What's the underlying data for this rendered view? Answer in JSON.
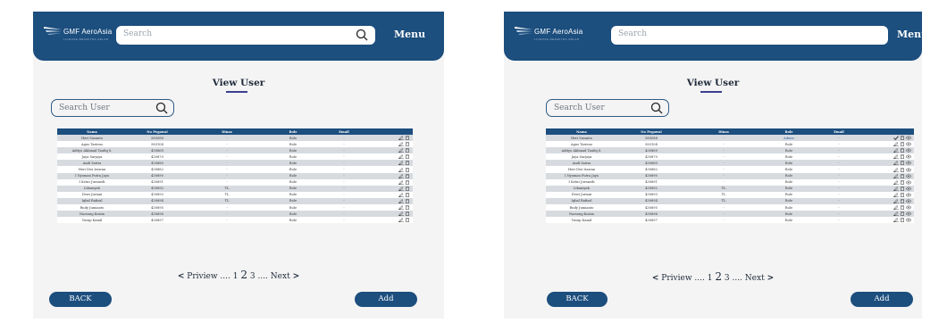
{
  "logo": {
    "name": "GMF AeroAsia",
    "tagline": "LICENSE BERMITRA ABLAR"
  },
  "header": {
    "search_placeholder": "Search",
    "menu_label": "Menu"
  },
  "page": {
    "title": "View User"
  },
  "user_search": {
    "placeholder": "Search User"
  },
  "columns": [
    "Nama",
    "No Pegawai",
    "Dinas",
    "Role",
    "Email"
  ],
  "rows_left": [
    [
      "Heri Susanto",
      "583088",
      "-",
      "Role",
      "-"
    ],
    [
      "Agus Tarieno",
      "583104",
      "-",
      "Role",
      "-"
    ],
    [
      "Adityo Akhmad Taufiq S.",
      "430869",
      "-",
      "Role",
      "-"
    ],
    [
      "Jaya Surjaya",
      "430870",
      "-",
      "Role",
      "-"
    ],
    [
      "Andi Satria",
      "430880",
      "-",
      "Role",
      "-"
    ],
    [
      "Heri Dwi Irawan",
      "430882",
      "-",
      "Role",
      "-"
    ],
    [
      "I Nyoman Putra Jaya",
      "430890",
      "-",
      "Role",
      "-"
    ],
    [
      "I Ketut Jurnaedi",
      "430891",
      "-",
      "Role",
      "-"
    ],
    [
      "Libaniyah",
      "430892",
      "TL",
      "Role",
      "-"
    ],
    [
      "Dewi Juriani",
      "430893",
      "TL",
      "Role",
      "-"
    ],
    [
      "Iqbal Rafizal",
      "430894",
      "TL",
      "Role",
      "-"
    ],
    [
      "Rudy Jumianto",
      "430895",
      "-",
      "Role",
      "-"
    ],
    [
      "Narsong Kosim",
      "430896",
      "-",
      "Role",
      "-"
    ],
    [
      "Yusup Kamil",
      "430897",
      "-",
      "Role",
      "-"
    ]
  ],
  "rows_right": [
    [
      "Heri Susanto",
      "583088",
      "-",
      "Admin",
      "-"
    ],
    [
      "Agus Tarieno",
      "583104",
      "-",
      "Role",
      "-"
    ],
    [
      "Adityo Akhmad Taufiq S.",
      "430869",
      "-",
      "Role",
      "-"
    ],
    [
      "Jaya Surjaya",
      "430870",
      "-",
      "Role",
      "-"
    ],
    [
      "Andi Satria",
      "430880",
      "-",
      "Role",
      "-"
    ],
    [
      "Heri Dwi Irawan",
      "430882",
      "-",
      "Role",
      "-"
    ],
    [
      "I Nyoman Putra Jaya",
      "430890",
      "-",
      "Role",
      "-"
    ],
    [
      "I Ketut Jurnaedi",
      "430891",
      "-",
      "Role",
      "-"
    ],
    [
      "Libaniyah",
      "430892",
      "TL",
      "Role",
      "-"
    ],
    [
      "Dewi Juriani",
      "430893",
      "TL",
      "Role",
      "-"
    ],
    [
      "Iqbal Rafizal",
      "430894",
      "TL",
      "Role",
      "-"
    ],
    [
      "Rudy Jumianto",
      "430895",
      "-",
      "Role",
      "-"
    ],
    [
      "Narsong Kosim",
      "430896",
      "-",
      "Role",
      "-"
    ],
    [
      "Yusup Kamil",
      "430897",
      "-",
      "Role",
      "-"
    ]
  ],
  "pagination": {
    "prev": "Priview",
    "dots": "....",
    "page1": "1",
    "page2": "2",
    "page3": "3",
    "next": "Next"
  },
  "buttons": {
    "back": "BACK",
    "add": "Add"
  },
  "icons": {
    "edit": "edit-icon",
    "delete": "trash-icon",
    "view": "eye-icon",
    "check": "check-icon"
  },
  "colors": {
    "primary": "#1c4e7e",
    "row_alt": "#d7dbe0",
    "background": "#f4f4f4"
  }
}
